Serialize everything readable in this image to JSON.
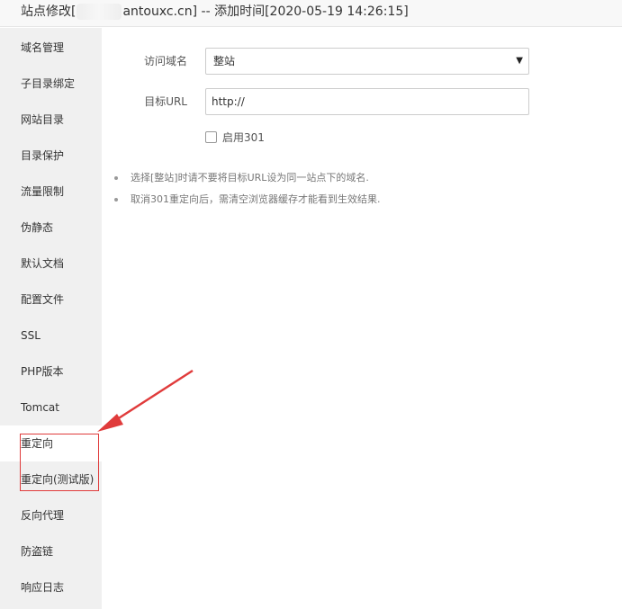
{
  "window": {
    "title_prefix": "站点修改[",
    "title_suffix": "antouxc.cn] -- 添加时间[2020-05-19 14:26:15]"
  },
  "sidebar": {
    "items": [
      {
        "label": "域名管理"
      },
      {
        "label": "子目录绑定"
      },
      {
        "label": "网站目录"
      },
      {
        "label": "目录保护"
      },
      {
        "label": "流量限制"
      },
      {
        "label": "伪静态"
      },
      {
        "label": "默认文档"
      },
      {
        "label": "配置文件"
      },
      {
        "label": "SSL"
      },
      {
        "label": "PHP版本"
      },
      {
        "label": "Tomcat"
      },
      {
        "label": "重定向",
        "active": true
      },
      {
        "label": "重定向(测试版)"
      },
      {
        "label": "反向代理"
      },
      {
        "label": "防盗链"
      },
      {
        "label": "响应日志"
      }
    ]
  },
  "form": {
    "domain_label": "访问域名",
    "domain_value": "整站",
    "target_label": "目标URL",
    "target_value": "http://",
    "enable301_label": "启用301",
    "enable301_checked": false
  },
  "tips": [
    "选择[整站]时请不要将目标URL设为同一站点下的域名.",
    "取消301重定向后，需清空浏览器缓存才能看到生效结果."
  ],
  "annotation": {
    "color": "#e03b3b",
    "caret_icon": "chevron-down-icon"
  }
}
